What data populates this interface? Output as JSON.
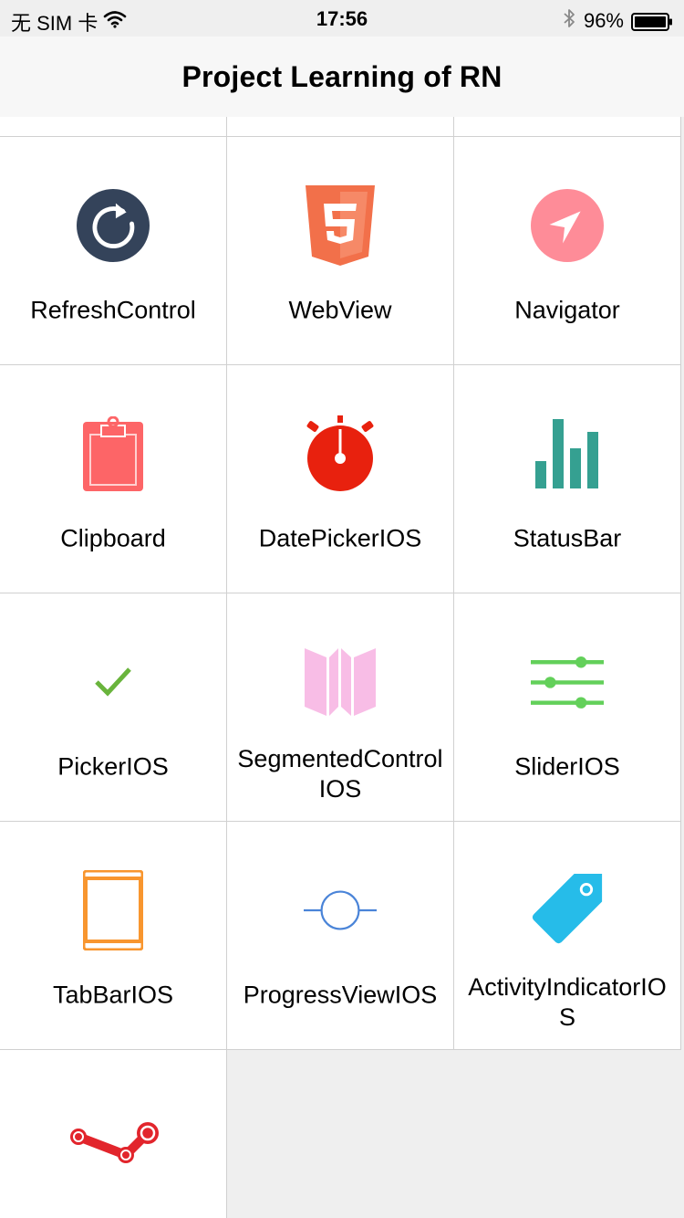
{
  "status_bar": {
    "carrier": "无 SIM 卡",
    "time": "17:56",
    "battery": "96%",
    "wifi_icon": "wifi-icon",
    "bluetooth_icon": "bluetooth-icon",
    "battery_icon": "battery-icon"
  },
  "nav": {
    "title": "Project Learning of RN"
  },
  "items": [
    {
      "label": "RefreshControl",
      "icon": "refresh-icon",
      "color": "#34435a"
    },
    {
      "label": "WebView",
      "icon": "html5-icon",
      "color": "#f2704a"
    },
    {
      "label": "Navigator",
      "icon": "navigation-arrow-icon",
      "color": "#fe8c98"
    },
    {
      "label": "Clipboard",
      "icon": "clipboard-icon",
      "color": "#fd6567"
    },
    {
      "label": "DatePickerIOS",
      "icon": "stopwatch-icon",
      "color": "#e8210e"
    },
    {
      "label": "StatusBar",
      "icon": "bar-chart-icon",
      "color": "#35a091"
    },
    {
      "label": "PickerIOS",
      "icon": "checkmark-icon",
      "color": "#69b43c"
    },
    {
      "label": "SegmentedControlIOS",
      "icon": "folded-map-icon",
      "color": "#f8bde6"
    },
    {
      "label": "SliderIOS",
      "icon": "sliders-icon",
      "color": "#63d05a"
    },
    {
      "label": "TabBarIOS",
      "icon": "tablet-icon",
      "color": "#f8962f"
    },
    {
      "label": "ProgressViewIOS",
      "icon": "progress-circle-icon",
      "color": "#4a84d8"
    },
    {
      "label": "ActivityIndicatorIOS",
      "icon": "tag-icon",
      "color": "#26bce9"
    },
    {
      "label": "",
      "icon": "steam-icon",
      "color": "#e2252c"
    }
  ]
}
